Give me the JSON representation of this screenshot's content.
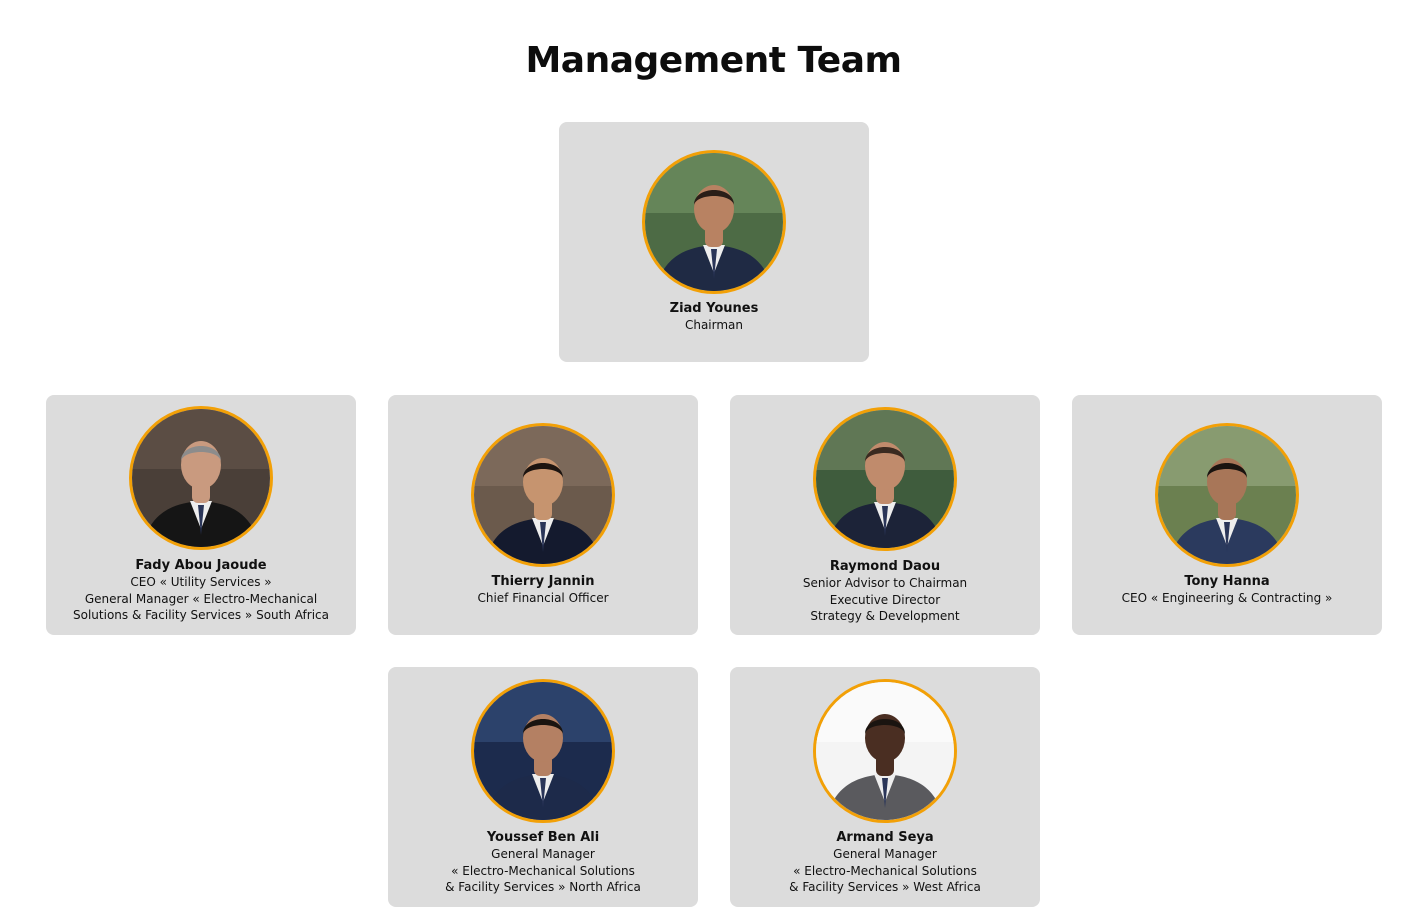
{
  "page": {
    "title": "Management Team"
  },
  "members": [
    {
      "name": "Ziad Younes",
      "roles": [
        "Chairman"
      ],
      "photo_bg": "#4d6b45",
      "photo_top": "#7a9a6a",
      "suit": "#1f2a44",
      "skin": "#b88262",
      "hair": "#2a1e18"
    },
    {
      "name": "Fady Abou Jaoude",
      "roles": [
        "CEO « Utility Services »",
        "General Manager « Electro-Mechanical",
        "Solutions & Facility Services » South Africa"
      ],
      "photo_bg": "#4a3f38",
      "photo_top": "#6a5a4e",
      "suit": "#151515",
      "skin": "#c99a7f",
      "hair": "#8c8c8c"
    },
    {
      "name": "Thierry Jannin",
      "roles": [
        "Chief Financial Officer"
      ],
      "photo_bg": "#6b5a4c",
      "photo_top": "#8a7766",
      "suit": "#141a2e",
      "skin": "#c6946f",
      "hair": "#1c1410"
    },
    {
      "name": "Raymond Daou",
      "roles": [
        "Senior Advisor to Chairman",
        "Executive Director",
        "Strategy & Development"
      ],
      "photo_bg": "#3f5c3d",
      "photo_top": "#7b8e6a",
      "suit": "#1c2338",
      "skin": "#c08b6c",
      "hair": "#3a2a20"
    },
    {
      "name": "Tony Hanna",
      "roles": [
        "CEO « Engineering & Contracting »"
      ],
      "photo_bg": "#6b8050",
      "photo_top": "#a0b08a",
      "suit": "#2b3a5e",
      "skin": "#a87658",
      "hair": "#1a1410"
    },
    {
      "name": "Youssef Ben Ali",
      "roles": [
        "General Manager",
        "« Electro-Mechanical Solutions",
        "& Facility Services » North Africa"
      ],
      "photo_bg": "#1c2b4d",
      "photo_top": "#3b5585",
      "suit": "#1d2a4a",
      "skin": "#b48063",
      "hair": "#1a1410"
    },
    {
      "name": "Armand Seya",
      "roles": [
        "General Manager",
        "« Electro-Mechanical Solutions",
        "& Facility Services » West Africa"
      ],
      "photo_bg": "#f4f4f4",
      "photo_top": "#ffffff",
      "suit": "#5a5a5e",
      "skin": "#4a2e22",
      "hair": "#1a1410"
    }
  ],
  "colors": {
    "card_bg": "#dcdcdc",
    "ring": "#f2a007",
    "text": "#111111"
  }
}
